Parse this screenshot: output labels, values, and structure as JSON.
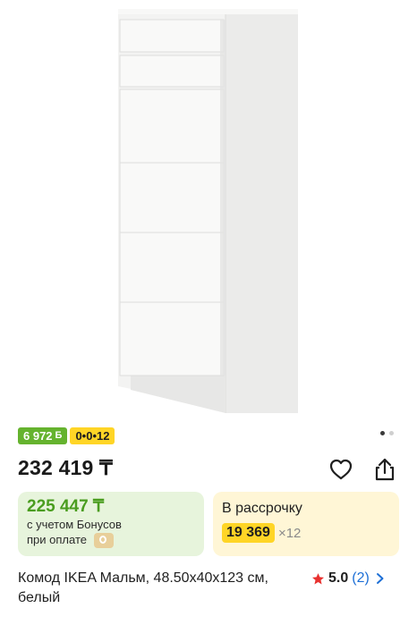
{
  "product": {
    "price": "232 419 ₸",
    "title": "Комод IKEA Мальм, 48.50x40x123 см, белый"
  },
  "badges": {
    "bonus_amount": "6 972",
    "bonus_glyph": "Б",
    "installment": "0•0•12"
  },
  "bonus_card": {
    "price": "225 447 ₸",
    "note_line1": "с учетом Бонусов",
    "note_line2": "при оплате"
  },
  "installment_card": {
    "title": "В рассрочку",
    "amount": "19 369",
    "months": "×12"
  },
  "rating": {
    "value": "5.0",
    "count": "(2)"
  },
  "gallery": {
    "slide_count": 2,
    "active_index": 0
  },
  "colors": {
    "bonus_green": "#65b32e",
    "installment_yellow": "#ffd526",
    "link_blue": "#1d6fd6",
    "star_red": "#e8312f"
  },
  "icons": [
    "heart-outline-icon",
    "share-icon",
    "star-icon",
    "chevron-right-icon"
  ]
}
